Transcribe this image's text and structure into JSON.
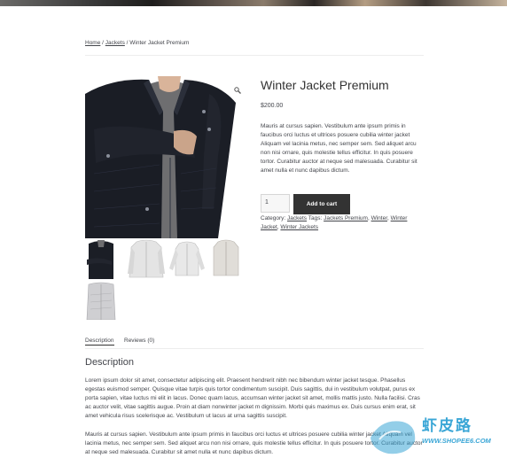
{
  "breadcrumb": {
    "home": "Home",
    "sep1": "/",
    "jackets": "Jackets",
    "sep2": "/",
    "current": "Winter Jacket Premium"
  },
  "product": {
    "title": "Winter Jacket Premium",
    "price": "$200.00",
    "short_description": "Mauris at cursus sapien. Vestibulum ante ipsum primis in faucibus orci luctus et ultrices posuere cubilia winter jacket Aliquam vel lacinia metus, nec semper sem. Sed aliquet arcu non nisi ornare, quis molestie tellus efficitur. In quis posuere tortor. Curabitur auctor at neque sed malesuada. Curabitur sit amet nulla et nunc dapibus dictum.",
    "quantity": "1",
    "add_to_cart": "Add to cart"
  },
  "meta": {
    "category_label": "Category:",
    "category": "Jackets",
    "tags_label": "Tags:",
    "tags": [
      "Jackets Premium",
      "Winter",
      "Winter Jacket",
      "Winter Jackets"
    ],
    "comma": ","
  },
  "tabs": {
    "description": "Description",
    "reviews": "Reviews (0)"
  },
  "description": {
    "heading": "Description",
    "para1": "Lorem ipsum dolor sit amet, consectetur adipiscing elit. Praesent hendrerit nibh nec bibendum winter jacket tesque. Phasellus egestas euismod semper. Quisque vitae turpis quis tortor condimentum suscipit. Duis sagittis, dui in vestibulum volutpat, purus ex porta sapien, vitae luctus mi elit in lacus. Donec quam lacus, accumsan winter jacket sit amet, mollis mattis justo. Nulla facilisi. Cras ac auctor velit, vitae sagittis augue. Proin at diam nonwinter jacket m dignissim. Morbi quis maximus ex. Duis cursus enim erat, sit amet vehicula risus scelerisque ac. Vestibulum ut lacus at urna sagittis suscipit.",
    "para2": "Mauris at cursus sapien. Vestibulum ante ipsum primis in faucibus orci luctus et ultrices posuere cubilia winter jacket Aliquam vel lacinia metus, nec semper sem. Sed aliquet arcu non nisi ornare, quis molestie tellus efficitur. In quis posuere tortor. Curabitur auctor at neque sed malesuada. Curabitur sit amet nulla et nunc dapibus dictum."
  },
  "watermark": {
    "title": "虾皮路",
    "url": "WWW.SHOPEE6.COM"
  },
  "icons": {
    "zoom": "magnifier-icon"
  },
  "colors": {
    "button_bg": "#333333",
    "text": "#43454b",
    "watermark": "#3aa6d6"
  }
}
